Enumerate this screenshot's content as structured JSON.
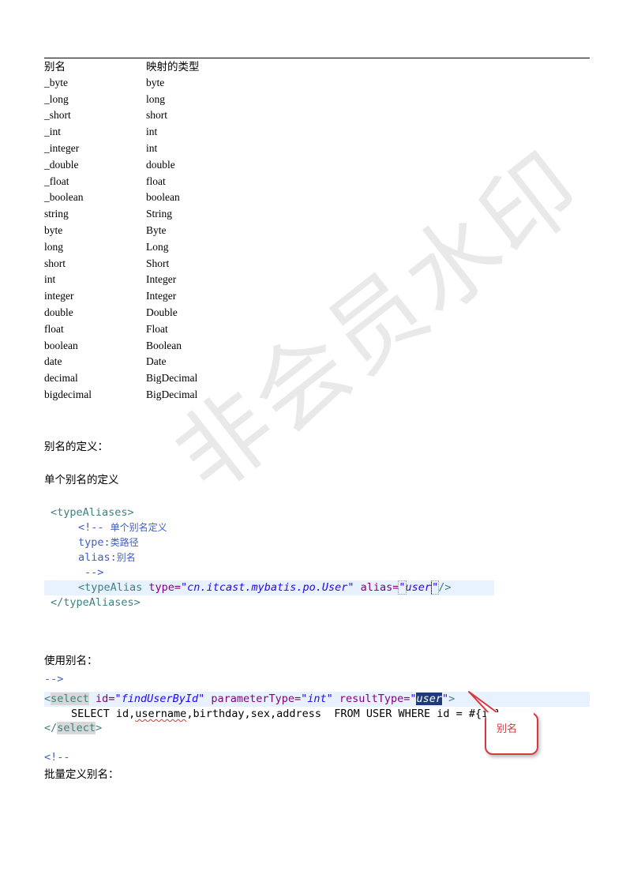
{
  "alias_table": {
    "header": {
      "alias": "别名",
      "type": "映射的类型"
    },
    "rows": [
      {
        "alias": "_byte",
        "type": "byte"
      },
      {
        "alias": "_long",
        "type": "long"
      },
      {
        "alias": "_short",
        "type": "short"
      },
      {
        "alias": "_int",
        "type": "int"
      },
      {
        "alias": "_integer",
        "type": "int"
      },
      {
        "alias": "_double",
        "type": "double"
      },
      {
        "alias": "_float",
        "type": "float"
      },
      {
        "alias": "_boolean",
        "type": "boolean"
      },
      {
        "alias": "string",
        "type": "String"
      },
      {
        "alias": "byte",
        "type": "Byte"
      },
      {
        "alias": "long",
        "type": "Long"
      },
      {
        "alias": "short",
        "type": "Short"
      },
      {
        "alias": "int",
        "type": "Integer"
      },
      {
        "alias": "integer",
        "type": "Integer"
      },
      {
        "alias": "double",
        "type": "Double"
      },
      {
        "alias": "float",
        "type": "Float"
      },
      {
        "alias": "boolean",
        "type": "Boolean"
      },
      {
        "alias": "date",
        "type": "Date"
      },
      {
        "alias": "decimal",
        "type": "BigDecimal"
      },
      {
        "alias": "bigdecimal",
        "type": "BigDecimal"
      }
    ]
  },
  "section_alias_def": "别名的定义：",
  "section_single_alias": "单个别名的定义",
  "code_block_1": {
    "open_tag": "<typeAliases>",
    "comment_open": "<!-- ",
    "comment_title": "单个别名定义",
    "type_key": "type:",
    "type_desc": "类路径",
    "alias_key": "alias:",
    "alias_desc": "别名",
    "comment_close": "-->",
    "elem_open": "<typeAlias ",
    "attr_type": "type=",
    "attr_type_val": "\"cn.itcast.mybatis.po.User\"",
    "attr_alias": " alias=",
    "attr_alias_val_q1": "\"",
    "attr_alias_val": "user",
    "attr_alias_val_q2": "\"",
    "elem_close": "/>",
    "close_tag": "</typeAliases>"
  },
  "section_use_alias": "使用别名：",
  "code_block_2": {
    "prev_line": "-->",
    "lt": "<",
    "select_tag": "select",
    "id_attr": " id=",
    "id_val": "\"findUserById\"",
    "param_attr": " parameterType=",
    "param_val": "\"int\"",
    "result_attr": " resultType=",
    "result_q": "\"",
    "result_val": "user",
    "result_q2": "\"",
    "gt": ">",
    "sql_pre": "SELECT id,",
    "sql_username": "username",
    "sql_post": ",birthday,sex,address  FROM USER WHERE id = #{id}",
    "close_lt": "</",
    "close_select": "select",
    "close_gt": ">",
    "next_comment": "<!--"
  },
  "callout_label": "别名",
  "section_batch": "批量定义别名：",
  "watermark": "非会员水印",
  "colors": {
    "tag": "#3f7f7f",
    "attr": "#7f007f",
    "value": "#2a00ff",
    "comment": "#3f5fbf",
    "line_highlight": "#e8f2fe",
    "callout": "#d9383e"
  }
}
